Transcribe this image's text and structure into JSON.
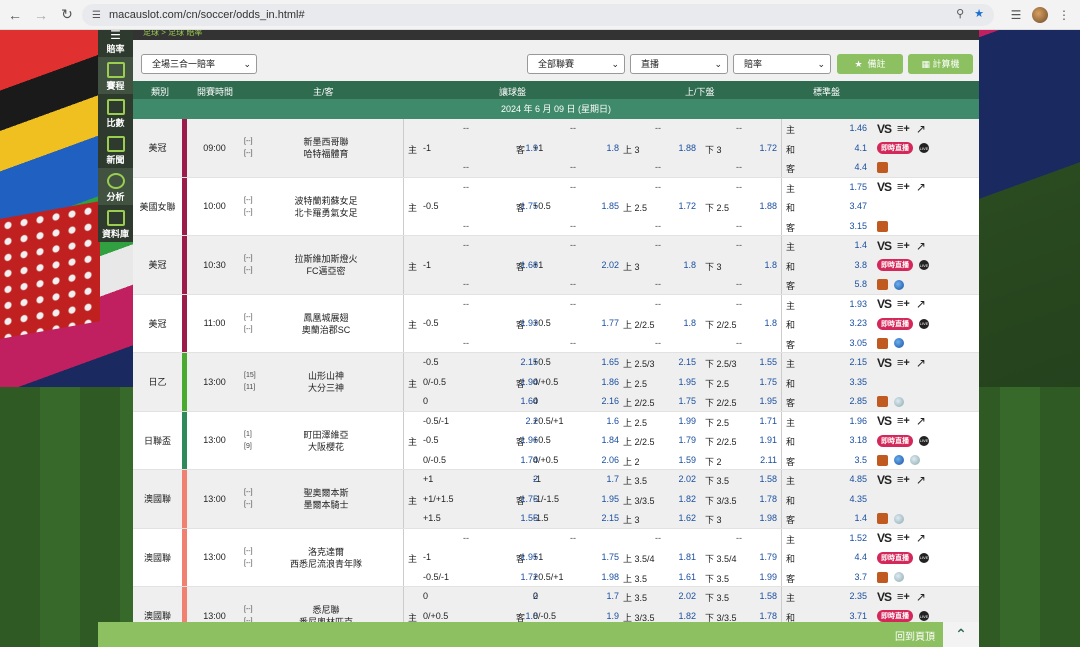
{
  "browser": {
    "url": "macauslot.com/cn/soccer/odds_in.html#"
  },
  "sidebar": [
    {
      "label": "賠率"
    },
    {
      "label": "賽程"
    },
    {
      "label": "比數"
    },
    {
      "label": "新聞"
    },
    {
      "label": "分析"
    },
    {
      "label": "資料庫"
    }
  ],
  "breadcrumb": "足球 > 足球 賠率",
  "filters": {
    "market": "全場三合一賠率",
    "league": "全部聯賽",
    "broadcast": "直播",
    "odds_type": "賠率",
    "note_button": "備註",
    "calc_button": "計算機"
  },
  "table": {
    "headers": [
      "類別",
      "開賽時間",
      "主/客",
      "讓球盤",
      "上/下盤",
      "標準盤"
    ],
    "date": "2024 年 6 月 09 日 (星期日)"
  },
  "colors": {
    "header_green": "#2e6b4f",
    "date_green": "#3f8a6a",
    "accent_green": "#8cc061",
    "odds_blue": "#1a4fa0",
    "live_pink": "#d4285a"
  },
  "matches": [
    {
      "league": "美冠",
      "time": "09:00",
      "bar": "#9b1b4b",
      "rank_home": "[--]",
      "rank_away": "[--]",
      "home": "新墨西哥聯",
      "away": "哈特福體育",
      "lines": [
        {
          "hv": "--",
          "ho": "",
          "av": "--",
          "ao": "",
          "ov": "--",
          "oo": "",
          "uv": "--",
          "uo": ""
        },
        {
          "hv": "-1",
          "ho": "1.9",
          "av": "+1",
          "ao": "1.8",
          "ov": "上 3",
          "oo": "1.88",
          "uv": "下 3",
          "uo": "1.72"
        },
        {
          "hv": "--",
          "ho": "",
          "av": "--",
          "ao": "",
          "ov": "--",
          "oo": "",
          "uv": "--",
          "uo": ""
        }
      ],
      "std": [
        "1.46",
        "4.1",
        "4.4"
      ],
      "row_icons": [
        [
          "vs",
          "list",
          "chart"
        ],
        [
          "live",
          "tv"
        ],
        [
          "logo"
        ]
      ]
    },
    {
      "league": "美國女聯",
      "time": "10:00",
      "bar": "#9b1b4b",
      "rank_home": "[--]",
      "rank_away": "[--]",
      "home": "波特蘭莉蘇女足",
      "away": "北卡羅勇氣女足",
      "lines": [
        {
          "hv": "--",
          "ho": "",
          "av": "--",
          "ao": "",
          "ov": "--",
          "oo": "",
          "uv": "--",
          "uo": ""
        },
        {
          "hv": "-0.5",
          "ho": "1.75",
          "av": "+0.5",
          "ao": "1.85",
          "ov": "上 2.5",
          "oo": "1.72",
          "uv": "下 2.5",
          "uo": "1.88"
        },
        {
          "hv": "--",
          "ho": "",
          "av": "--",
          "ao": "",
          "ov": "--",
          "oo": "",
          "uv": "--",
          "uo": ""
        }
      ],
      "std": [
        "1.75",
        "3.47",
        "3.15"
      ],
      "row_icons": [
        [
          "vs",
          "list",
          "chart"
        ],
        [],
        [
          "logo"
        ]
      ]
    },
    {
      "league": "美冠",
      "time": "10:30",
      "bar": "#9b1b4b",
      "rank_home": "[--]",
      "rank_away": "[--]",
      "home": "拉斯維加斯燈火",
      "away": "FC邁亞密",
      "lines": [
        {
          "hv": "--",
          "ho": "",
          "av": "--",
          "ao": "",
          "ov": "--",
          "oo": "",
          "uv": "--",
          "uo": ""
        },
        {
          "hv": "-1",
          "ho": "1.68",
          "av": "+1",
          "ao": "2.02",
          "ov": "上 3",
          "oo": "1.8",
          "uv": "下 3",
          "uo": "1.8"
        },
        {
          "hv": "--",
          "ho": "",
          "av": "--",
          "ao": "",
          "ov": "--",
          "oo": "",
          "uv": "--",
          "uo": ""
        }
      ],
      "std": [
        "1.4",
        "3.8",
        "5.8"
      ],
      "row_icons": [
        [
          "vs",
          "list",
          "chart"
        ],
        [
          "live",
          "tv"
        ],
        [
          "logo",
          "ball"
        ]
      ]
    },
    {
      "league": "美冠",
      "time": "11:00",
      "bar": "#9b1b4b",
      "rank_home": "[--]",
      "rank_away": "[--]",
      "home": "鳳凰城展翅",
      "away": "奧蘭治郡SC",
      "lines": [
        {
          "hv": "--",
          "ho": "",
          "av": "--",
          "ao": "",
          "ov": "--",
          "oo": "",
          "uv": "--",
          "uo": ""
        },
        {
          "hv": "-0.5",
          "ho": "1.93",
          "av": "+0.5",
          "ao": "1.77",
          "ov": "上 2/2.5",
          "oo": "1.8",
          "uv": "下 2/2.5",
          "uo": "1.8"
        },
        {
          "hv": "--",
          "ho": "",
          "av": "--",
          "ao": "",
          "ov": "--",
          "oo": "",
          "uv": "--",
          "uo": ""
        }
      ],
      "std": [
        "1.93",
        "3.23",
        "3.05"
      ],
      "row_icons": [
        [
          "vs",
          "list",
          "chart"
        ],
        [
          "live",
          "tv"
        ],
        [
          "logo",
          "ball"
        ]
      ]
    },
    {
      "league": "日乙",
      "time": "13:00",
      "bar": "#4aaa30",
      "rank_home": "[15]",
      "rank_away": "[11]",
      "home": "山形山神",
      "away": "大分三神",
      "lines": [
        {
          "hv": "-0.5",
          "ho": "2.15",
          "av": "+0.5",
          "ao": "1.65",
          "ov": "上 2.5/3",
          "oo": "2.15",
          "uv": "下 2.5/3",
          "uo": "1.55"
        },
        {
          "hv": "0/-0.5",
          "ho": "1.94",
          "av": "0/+0.5",
          "ao": "1.86",
          "ov": "上 2.5",
          "oo": "1.95",
          "uv": "下 2.5",
          "uo": "1.75"
        },
        {
          "hv": "0",
          "ho": "1.64",
          "av": "0",
          "ao": "2.16",
          "ov": "上 2/2.5",
          "oo": "1.75",
          "uv": "下 2/2.5",
          "uo": "1.95"
        }
      ],
      "std": [
        "2.15",
        "3.35",
        "2.85"
      ],
      "row_icons": [
        [
          "vs",
          "list",
          "chart"
        ],
        [],
        [
          "logo",
          "ball2"
        ]
      ]
    },
    {
      "league": "日聯盃",
      "time": "13:00",
      "bar": "#2e8a5a",
      "rank_home": "[1]",
      "rank_away": "[9]",
      "home": "町田澤維亞",
      "away": "大阪櫻花",
      "lines": [
        {
          "hv": "-0.5/-1",
          "ho": "2.2",
          "av": "+0.5/+1",
          "ao": "1.6",
          "ov": "上 2.5",
          "oo": "1.99",
          "uv": "下 2.5",
          "uo": "1.71"
        },
        {
          "hv": "-0.5",
          "ho": "1.96",
          "av": "+0.5",
          "ao": "1.84",
          "ov": "上 2/2.5",
          "oo": "1.79",
          "uv": "下 2/2.5",
          "uo": "1.91"
        },
        {
          "hv": "0/-0.5",
          "ho": "1.74",
          "av": "0/+0.5",
          "ao": "2.06",
          "ov": "上 2",
          "oo": "1.59",
          "uv": "下 2",
          "uo": "2.11"
        }
      ],
      "std": [
        "1.96",
        "3.18",
        "3.5"
      ],
      "row_icons": [
        [
          "vs",
          "list",
          "chart"
        ],
        [
          "live",
          "tv"
        ],
        [
          "logo",
          "ball",
          "ball2"
        ]
      ]
    },
    {
      "league": "澳國聯",
      "time": "13:00",
      "bar": "#f08070",
      "rank_home": "[--]",
      "rank_away": "[--]",
      "home": "聖奧爾本斯",
      "away": "墨爾本騎士",
      "lines": [
        {
          "hv": "+1",
          "ho": "2",
          "av": "-1",
          "ao": "1.7",
          "ov": "上 3.5",
          "oo": "2.02",
          "uv": "下 3.5",
          "uo": "1.58"
        },
        {
          "hv": "+1/+1.5",
          "ho": "1.75",
          "av": "-1/-1.5",
          "ao": "1.95",
          "ov": "上 3/3.5",
          "oo": "1.82",
          "uv": "下 3/3.5",
          "uo": "1.78"
        },
        {
          "hv": "+1.5",
          "ho": "1.55",
          "av": "-1.5",
          "ao": "2.15",
          "ov": "上 3",
          "oo": "1.62",
          "uv": "下 3",
          "uo": "1.98"
        }
      ],
      "std": [
        "4.85",
        "4.35",
        "1.4"
      ],
      "row_icons": [
        [
          "vs",
          "list",
          "chart"
        ],
        [],
        [
          "logo",
          "ball2"
        ]
      ]
    },
    {
      "league": "澳國聯",
      "time": "13:00",
      "bar": "#f08070",
      "rank_home": "[--]",
      "rank_away": "[--]",
      "home": "洛克達爾",
      "away": "西悉尼流浪青年隊",
      "lines": [
        {
          "hv": "--",
          "ho": "",
          "av": "--",
          "ao": "",
          "ov": "--",
          "oo": "",
          "uv": "--",
          "uo": ""
        },
        {
          "hv": "-1",
          "ho": "1.95",
          "av": "+1",
          "ao": "1.75",
          "ov": "上 3.5/4",
          "oo": "1.81",
          "uv": "下 3.5/4",
          "uo": "1.79"
        },
        {
          "hv": "-0.5/-1",
          "ho": "1.72",
          "av": "+0.5/+1",
          "ao": "1.98",
          "ov": "上 3.5",
          "oo": "1.61",
          "uv": "下 3.5",
          "uo": "1.99"
        }
      ],
      "std": [
        "1.52",
        "4.4",
        "3.7"
      ],
      "row_icons": [
        [
          "vs",
          "list",
          "chart"
        ],
        [
          "live",
          "tv"
        ],
        [
          "logo",
          "ball2"
        ]
      ]
    },
    {
      "league": "澳國聯",
      "time": "13:00",
      "bar": "#f08070",
      "rank_home": "[--]",
      "rank_away": "[--]",
      "home": "悉尼聯",
      "away": "悉尼奧林匹克",
      "lines": [
        {
          "hv": "0",
          "ho": "2",
          "av": "0",
          "ao": "1.7",
          "ov": "上 3.5",
          "oo": "2.02",
          "uv": "下 3.5",
          "uo": "1.58"
        },
        {
          "hv": "0/+0.5",
          "ho": "1.8",
          "av": "0/-0.5",
          "ao": "1.9",
          "ov": "上 3/3.5",
          "oo": "1.82",
          "uv": "下 3/3.5",
          "uo": "1.78"
        },
        {
          "hv": "",
          "ho": "",
          "av": "",
          "ao": "",
          "ov": "",
          "oo": "",
          "uv": "",
          "uo": ""
        }
      ],
      "std": [
        "2.35",
        "3.71",
        ""
      ],
      "row_icons": [
        [
          "vs",
          "list",
          "chart"
        ],
        [
          "live",
          "tv"
        ],
        []
      ]
    }
  ],
  "labels": {
    "home": "主",
    "away": "客",
    "draw": "和",
    "live": "即時直播",
    "tv": "LIVE"
  },
  "footer": {
    "back_top": "回到頁頂",
    "up_icon": "chevron-up-icon"
  }
}
